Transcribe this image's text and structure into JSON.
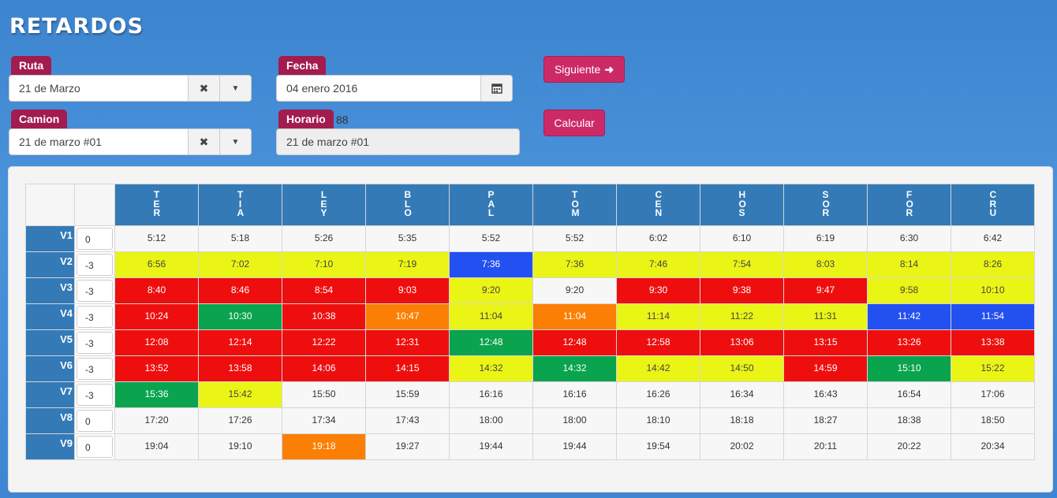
{
  "title": "RETARDOS",
  "ruta": {
    "label": "Ruta",
    "value": "21 de Marzo"
  },
  "fecha": {
    "label": "Fecha",
    "value": "04 enero 2016"
  },
  "camion": {
    "label": "Camion",
    "value": "21 de marzo #01"
  },
  "horario": {
    "label": "Horario",
    "count": "88",
    "value": "21 de marzo #01"
  },
  "buttons": {
    "siguiente": "Siguiente",
    "calcular": "Calcular"
  },
  "colors": {
    "white": "#f7f7f7",
    "yellow": "#eaf515",
    "red": "#ef0e0e",
    "green": "#0aa34e",
    "blue": "#2350f0",
    "orange": "#fb7f04",
    "header": "#337ab7",
    "accent": "#a31c4f"
  },
  "stops": [
    "TER",
    "TIA",
    "LEY",
    "BLO",
    "PAL",
    "TOM",
    "CEN",
    "HOS",
    "SOR",
    "FOR",
    "CRU"
  ],
  "rows": [
    {
      "label": "V1",
      "offset": "0",
      "times": [
        "5:12",
        "5:18",
        "5:26",
        "5:35",
        "5:52",
        "5:52",
        "6:02",
        "6:10",
        "6:19",
        "6:30",
        "6:42"
      ],
      "status": [
        "white",
        "white",
        "white",
        "white",
        "white",
        "white",
        "white",
        "white",
        "white",
        "white",
        "white"
      ]
    },
    {
      "label": "V2",
      "offset": "-3",
      "times": [
        "6:56",
        "7:02",
        "7:10",
        "7:19",
        "7:36",
        "7:36",
        "7:46",
        "7:54",
        "8:03",
        "8:14",
        "8:26"
      ],
      "status": [
        "yellow",
        "yellow",
        "yellow",
        "yellow",
        "blue",
        "yellow",
        "yellow",
        "yellow",
        "yellow",
        "yellow",
        "yellow"
      ]
    },
    {
      "label": "V3",
      "offset": "-3",
      "times": [
        "8:40",
        "8:46",
        "8:54",
        "9:03",
        "9:20",
        "9:20",
        "9:30",
        "9:38",
        "9:47",
        "9:58",
        "10:10"
      ],
      "status": [
        "red",
        "red",
        "red",
        "red",
        "yellow",
        "white",
        "red",
        "red",
        "red",
        "yellow",
        "yellow"
      ]
    },
    {
      "label": "V4",
      "offset": "-3",
      "times": [
        "10:24",
        "10:30",
        "10:38",
        "10:47",
        "11:04",
        "11:04",
        "11:14",
        "11:22",
        "11:31",
        "11:42",
        "11:54"
      ],
      "status": [
        "red",
        "green",
        "red",
        "orange",
        "yellow",
        "orange",
        "yellow",
        "yellow",
        "yellow",
        "blue",
        "blue"
      ]
    },
    {
      "label": "V5",
      "offset": "-3",
      "times": [
        "12:08",
        "12:14",
        "12:22",
        "12:31",
        "12:48",
        "12:48",
        "12:58",
        "13:06",
        "13:15",
        "13:26",
        "13:38"
      ],
      "status": [
        "red",
        "red",
        "red",
        "red",
        "green",
        "red",
        "red",
        "red",
        "red",
        "red",
        "red"
      ]
    },
    {
      "label": "V6",
      "offset": "-3",
      "times": [
        "13:52",
        "13:58",
        "14:06",
        "14:15",
        "14:32",
        "14:32",
        "14:42",
        "14:50",
        "14:59",
        "15:10",
        "15:22"
      ],
      "status": [
        "red",
        "red",
        "red",
        "red",
        "yellow",
        "green",
        "yellow",
        "yellow",
        "red",
        "green",
        "yellow"
      ]
    },
    {
      "label": "V7",
      "offset": "-3",
      "times": [
        "15:36",
        "15:42",
        "15:50",
        "15:59",
        "16:16",
        "16:16",
        "16:26",
        "16:34",
        "16:43",
        "16:54",
        "17:06"
      ],
      "status": [
        "green",
        "yellow",
        "white",
        "white",
        "white",
        "white",
        "white",
        "white",
        "white",
        "white",
        "white"
      ]
    },
    {
      "label": "V8",
      "offset": "0",
      "times": [
        "17:20",
        "17:26",
        "17:34",
        "17:43",
        "18:00",
        "18:00",
        "18:10",
        "18:18",
        "18:27",
        "18:38",
        "18:50"
      ],
      "status": [
        "white",
        "white",
        "white",
        "white",
        "white",
        "white",
        "white",
        "white",
        "white",
        "white",
        "white"
      ]
    },
    {
      "label": "V9",
      "offset": "0",
      "times": [
        "19:04",
        "19:10",
        "19:18",
        "19:27",
        "19:44",
        "19:44",
        "19:54",
        "20:02",
        "20:11",
        "20:22",
        "20:34"
      ],
      "status": [
        "white",
        "white",
        "orange",
        "white",
        "white",
        "white",
        "white",
        "white",
        "white",
        "white",
        "white"
      ]
    }
  ]
}
